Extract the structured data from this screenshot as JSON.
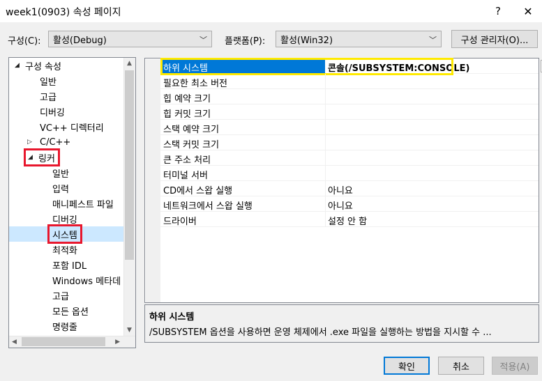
{
  "window": {
    "title": "week1(0903) 속성 페이지",
    "help_glyph": "?",
    "close_glyph": "✕"
  },
  "config_bar": {
    "config_label": "구성(C):",
    "config_value": "활성(Debug)",
    "platform_label": "플랫폼(P):",
    "platform_value": "활성(Win32)",
    "manager_button": "구성 관리자(O)..."
  },
  "tree": {
    "items": [
      {
        "label": "구성 속성",
        "expander": "◢"
      },
      {
        "label": "일반"
      },
      {
        "label": "고급"
      },
      {
        "label": "디버깅"
      },
      {
        "label": "VC++ 디렉터리"
      },
      {
        "label": "C/C++",
        "expander": "▷"
      },
      {
        "label": "링커",
        "expander": "◢"
      },
      {
        "label": "일반"
      },
      {
        "label": "입력"
      },
      {
        "label": "매니페스트 파일"
      },
      {
        "label": "디버깅"
      },
      {
        "label": "시스템"
      },
      {
        "label": "최적화"
      },
      {
        "label": "포함 IDL"
      },
      {
        "label": "Windows 메타데"
      },
      {
        "label": "고급"
      },
      {
        "label": "모든 옵션"
      },
      {
        "label": "명령줄"
      }
    ],
    "selected": "시스템"
  },
  "grid": {
    "rows": [
      {
        "name": "하위 시스템",
        "value": "콘솔(/SUBSYSTEM:CONSOLE)"
      },
      {
        "name": "필요한 최소 버전",
        "value": ""
      },
      {
        "name": "힙 예약 크기",
        "value": ""
      },
      {
        "name": "힙 커밋 크기",
        "value": ""
      },
      {
        "name": "스택 예약 크기",
        "value": ""
      },
      {
        "name": "스택 커밋 크기",
        "value": ""
      },
      {
        "name": "큰 주소 처리",
        "value": ""
      },
      {
        "name": "터미널 서버",
        "value": ""
      },
      {
        "name": "CD에서 스왑 실행",
        "value": "아니요"
      },
      {
        "name": "네트워크에서 스왑 실행",
        "value": "아니요"
      },
      {
        "name": "드라이버",
        "value": "설정 안 함"
      }
    ]
  },
  "description": {
    "title": "하위 시스템",
    "text": "/SUBSYSTEM 옵션을 사용하면 운영 체제에서 .exe 파일을 실행하는 방법을 지시할 수 ..."
  },
  "footer": {
    "ok": "확인",
    "cancel": "취소",
    "apply": "적용(A)"
  },
  "colors": {
    "selection_blue": "#0078d7",
    "tree_selection": "#cce8ff",
    "highlight_red": "#e8172d",
    "highlight_yellow": "#ffea00"
  }
}
